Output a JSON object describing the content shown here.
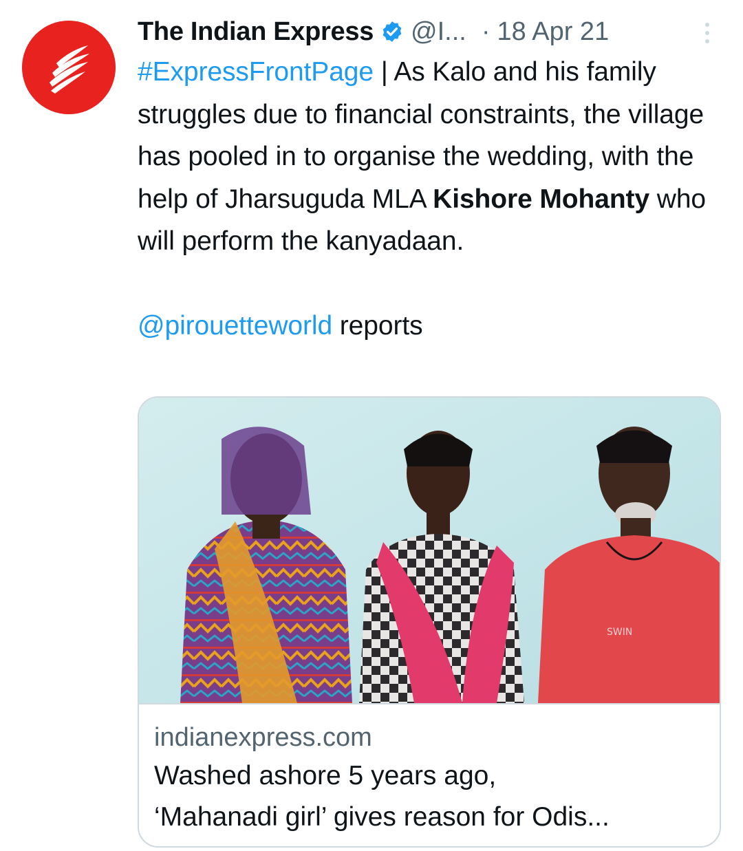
{
  "tweet": {
    "author": {
      "display_name": "The Indian Express",
      "handle": "@I...",
      "verified": true,
      "avatar_icon": "indian-express-logo-icon",
      "avatar_color": "#e8231f"
    },
    "separator": "·",
    "date": "18 Apr 21",
    "more_icon": "vertical-more-icon",
    "text": {
      "hashtag": "#ExpressFrontPage",
      "part1": " | As Kalo and his family struggles due to financial constraints, the village has pooled in to organise the wedding, with the help of Jharsuguda MLA ",
      "bold_name": "Kishore Mohanty",
      "part2": " who will perform the kanyadaan.",
      "mention": "@pirouetteworld",
      "mention_suffix": " reports"
    },
    "link_card": {
      "domain": "indianexpress.com",
      "title_line1": "Washed ashore 5 years ago,",
      "title_line2": "‘Mahanadi girl’ gives reason for Odis..."
    }
  },
  "colors": {
    "link": "#1d9bf0",
    "secondary_text": "#536471",
    "border": "#cfd9de",
    "verified": "#1d9bf0"
  }
}
